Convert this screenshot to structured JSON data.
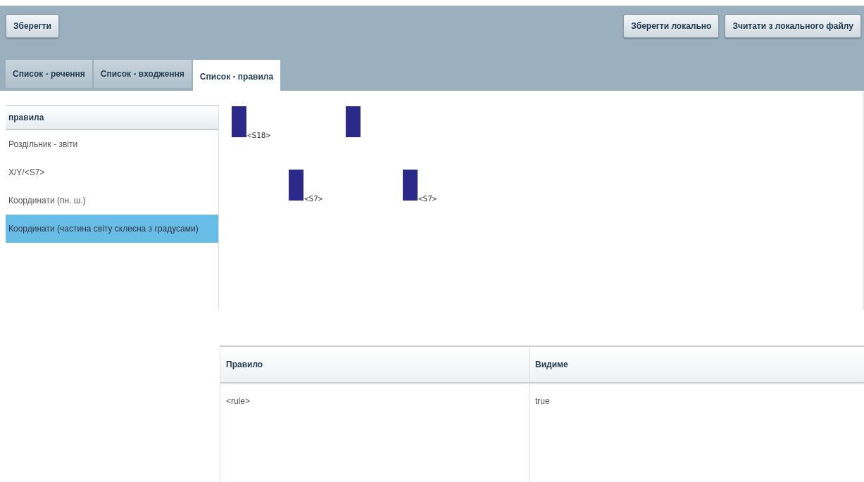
{
  "toolbar": {
    "left_buttons": [
      "Зберегти"
    ],
    "right_buttons": [
      "Зберегти локально",
      "Зчитати з локального файлу"
    ]
  },
  "tabs": [
    {
      "label": "Список - речення",
      "selected": false
    },
    {
      "label": "Список - входження",
      "selected": false
    },
    {
      "label": "Список - правила",
      "selected": true
    }
  ],
  "rules_list": {
    "header": "правила",
    "items": [
      {
        "label": "Роздільник - звіти",
        "selected": false
      },
      {
        "label": "X/Y/<S7>",
        "selected": false
      },
      {
        "label": "Координати (пн. ш.)",
        "selected": false
      },
      {
        "label": "Координати (частина світу склеєна з градусами)",
        "selected": true
      }
    ]
  },
  "canvas": {
    "nodes": [
      {
        "kind": "block",
        "label": "<S18>"
      },
      {
        "kind": "block"
      },
      {
        "kind": "block",
        "label": "<S7>"
      },
      {
        "kind": "block",
        "label": "<S7>"
      }
    ]
  },
  "table": {
    "columns": [
      "Правило",
      "Видиме"
    ],
    "rows": [
      [
        "<rule>",
        "true"
      ]
    ]
  }
}
